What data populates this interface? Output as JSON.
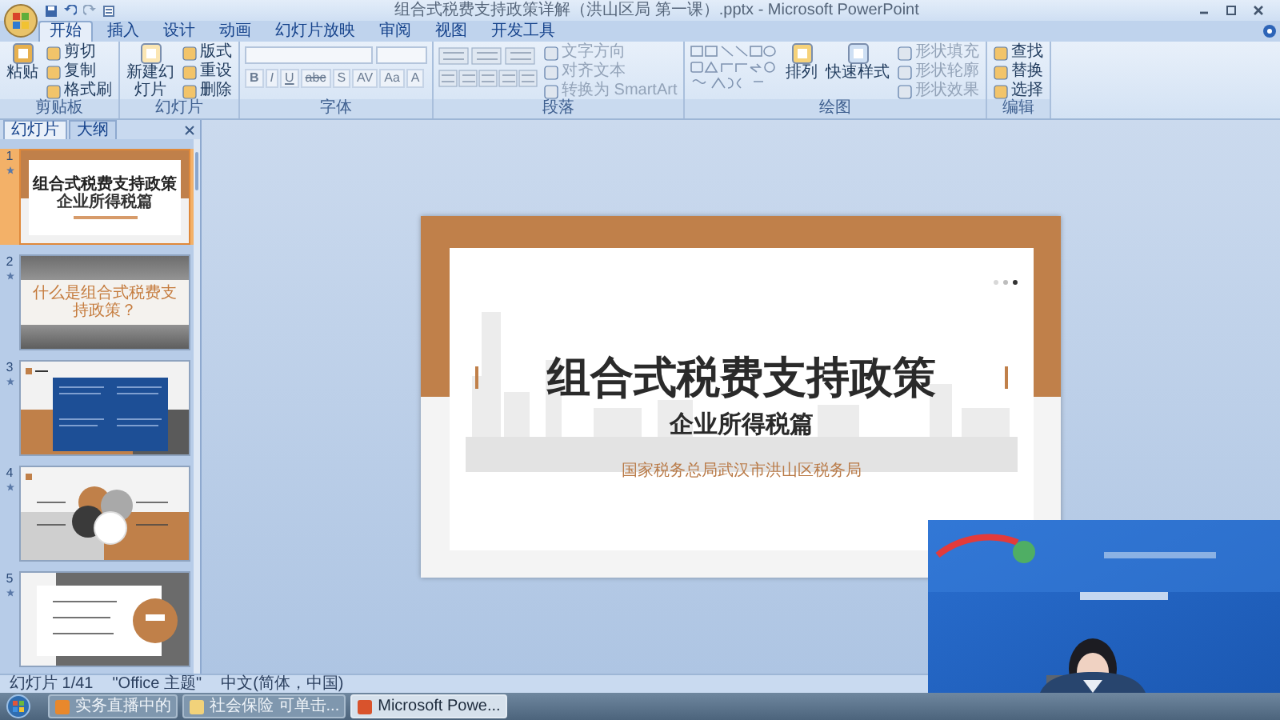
{
  "window": {
    "title": "组合式税费支持政策详解（洪山区局 第一课）.pptx - Microsoft PowerPoint"
  },
  "ribbon_tabs": [
    {
      "label": "开始",
      "selected": true
    },
    {
      "label": "插入",
      "selected": false
    },
    {
      "label": "设计",
      "selected": false
    },
    {
      "label": "动画",
      "selected": false
    },
    {
      "label": "幻灯片放映",
      "selected": false
    },
    {
      "label": "审阅",
      "selected": false
    },
    {
      "label": "视图",
      "selected": false
    },
    {
      "label": "开发工具",
      "selected": false
    }
  ],
  "ribbon_groups": [
    {
      "kind": "clipboard",
      "label": "剪贴板",
      "big": [
        "粘贴"
      ],
      "items": [
        {
          "label": "剪切",
          "disabled": false
        },
        {
          "label": "复制",
          "disabled": false
        },
        {
          "label": "格式刷",
          "disabled": false
        }
      ]
    },
    {
      "kind": "slides",
      "label": "幻灯片",
      "big": [
        "新建幻灯片"
      ],
      "items": [
        {
          "label": "版式",
          "disabled": false
        },
        {
          "label": "重设",
          "disabled": false
        },
        {
          "label": "删除",
          "disabled": false
        }
      ]
    },
    {
      "kind": "font",
      "label": "字体",
      "buttons": [
        "B",
        "I",
        "U",
        "abc",
        "S",
        "AV",
        "Aa",
        "A"
      ]
    },
    {
      "kind": "paragraph",
      "label": "段落",
      "items": [
        {
          "label": "文字方向",
          "disabled": true
        },
        {
          "label": "对齐文本",
          "disabled": true
        },
        {
          "label": "转换为 SmartArt",
          "disabled": true
        }
      ]
    },
    {
      "kind": "drawing",
      "label": "绘图",
      "big": [
        "排列",
        "快速样式"
      ],
      "items": [
        {
          "label": "形状填充",
          "disabled": true
        },
        {
          "label": "形状轮廓",
          "disabled": true
        },
        {
          "label": "形状效果",
          "disabled": true
        }
      ]
    },
    {
      "kind": "editing",
      "label": "编辑",
      "items": [
        {
          "label": "查找",
          "disabled": false
        },
        {
          "label": "替换",
          "disabled": false
        },
        {
          "label": "选择",
          "disabled": false
        }
      ]
    }
  ],
  "panel_tabs": [
    {
      "label": "幻灯片",
      "selected": true
    },
    {
      "label": "大纲",
      "selected": false
    }
  ],
  "slides": [
    {
      "number": "1",
      "selected": true,
      "kind": "title",
      "title": "组合式税费支持政策",
      "subtitle": "企业所得税篇"
    },
    {
      "number": "2",
      "selected": false,
      "kind": "question",
      "title": "什么是组合式税费支持政策？"
    },
    {
      "number": "3",
      "selected": false,
      "kind": "blue_grid"
    },
    {
      "number": "4",
      "selected": false,
      "kind": "circles"
    },
    {
      "number": "5",
      "selected": false,
      "kind": "contents"
    }
  ],
  "current_slide": {
    "title": "组合式税费支持政策",
    "subtitle": "企业所得税篇",
    "organization": "国家税务总局武汉市洪山区税务局"
  },
  "status_bar": [
    "幻灯片 1/41",
    "\"Office 主题\"",
    "中文(简体，中国)"
  ],
  "taskbar": [
    {
      "label": "实务直播中的",
      "selected": false
    },
    {
      "label": "社会保险 可单击...",
      "selected": false
    },
    {
      "label": "Microsoft Powe...",
      "selected": true
    }
  ]
}
